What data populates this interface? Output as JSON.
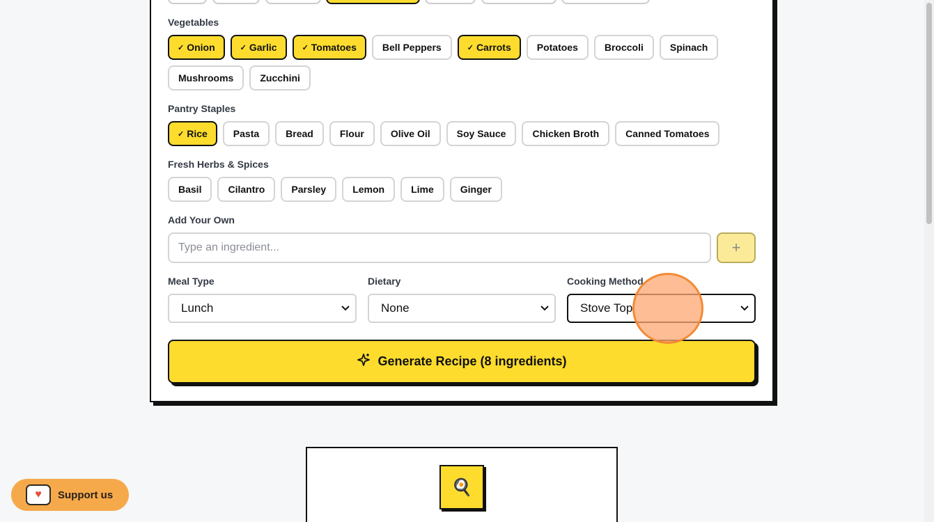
{
  "vegetables": {
    "label": "Vegetables",
    "chips": [
      {
        "label": "Onion",
        "selected": true
      },
      {
        "label": "Garlic",
        "selected": true
      },
      {
        "label": "Tomatoes",
        "selected": true
      },
      {
        "label": "Bell Peppers",
        "selected": false
      },
      {
        "label": "Carrots",
        "selected": true
      },
      {
        "label": "Potatoes",
        "selected": false
      },
      {
        "label": "Broccoli",
        "selected": false
      },
      {
        "label": "Spinach",
        "selected": false
      },
      {
        "label": "Mushrooms",
        "selected": false
      },
      {
        "label": "Zucchini",
        "selected": false
      }
    ]
  },
  "pantry": {
    "label": "Pantry Staples",
    "chips": [
      {
        "label": "Rice",
        "selected": true
      },
      {
        "label": "Pasta",
        "selected": false
      },
      {
        "label": "Bread",
        "selected": false
      },
      {
        "label": "Flour",
        "selected": false
      },
      {
        "label": "Olive Oil",
        "selected": false
      },
      {
        "label": "Soy Sauce",
        "selected": false
      },
      {
        "label": "Chicken Broth",
        "selected": false
      },
      {
        "label": "Canned Tomatoes",
        "selected": false
      }
    ]
  },
  "herbs": {
    "label": "Fresh Herbs & Spices",
    "chips": [
      {
        "label": "Basil",
        "selected": false
      },
      {
        "label": "Cilantro",
        "selected": false
      },
      {
        "label": "Parsley",
        "selected": false
      },
      {
        "label": "Lemon",
        "selected": false
      },
      {
        "label": "Lime",
        "selected": false
      },
      {
        "label": "Ginger",
        "selected": false
      }
    ]
  },
  "add_own": {
    "label": "Add Your Own",
    "placeholder": "Type an ingredient...",
    "add_symbol": "+"
  },
  "options": {
    "meal_type": {
      "label": "Meal Type",
      "value": "Lunch"
    },
    "dietary": {
      "label": "Dietary",
      "value": "None"
    },
    "cooking_method": {
      "label": "Cooking Method",
      "value": "Stove Top"
    }
  },
  "generate": {
    "label": "Generate Recipe (8 ingredients)",
    "icon": "sparkles-icon"
  },
  "preview": {
    "icon": "pan-egg-icon",
    "glyph": "🍳"
  },
  "support": {
    "label": "Support us",
    "icon": "heart-cup-icon"
  },
  "colors": {
    "accent": "#fddc2e",
    "border": "#111111",
    "click_indicator": "#f28a35"
  },
  "check_glyph": "✓"
}
